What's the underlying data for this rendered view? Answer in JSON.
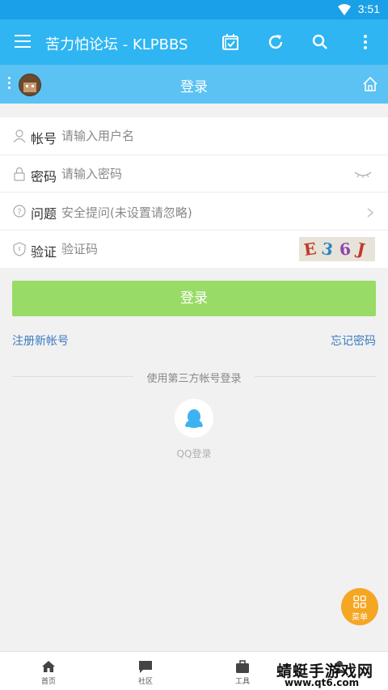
{
  "status_bar": {
    "time": "3:51"
  },
  "app_bar": {
    "title": "苦力怕论坛 - KLPBBS"
  },
  "sub_bar": {
    "title": "登录"
  },
  "form": {
    "username": {
      "label": "帐号",
      "placeholder": "请输入用户名"
    },
    "password": {
      "label": "密码",
      "placeholder": "请输入密码"
    },
    "question": {
      "label": "问题",
      "value": "安全提问(未设置请忽略)"
    },
    "captcha": {
      "label": "验证",
      "placeholder": "验证码",
      "image_text": [
        "E",
        "3",
        "6",
        "J"
      ]
    }
  },
  "login_button": "登录",
  "links": {
    "register": "注册新帐号",
    "forgot": "忘记密码"
  },
  "third_party": {
    "divider_text": "使用第三方帐号登录",
    "qq_label": "QQ登录"
  },
  "fab": {
    "label": "菜单"
  },
  "bottom_tabs": [
    {
      "label": "首页",
      "icon": "home-icon"
    },
    {
      "label": "社区",
      "icon": "chat-icon"
    },
    {
      "label": "工具",
      "icon": "briefcase-icon"
    },
    {
      "label": "",
      "icon": "profile-icon"
    }
  ],
  "watermark": {
    "line1": "蜻蜓手游戏网",
    "line2": "www.qt6.com"
  },
  "colors": {
    "primary": "#2eb5f2",
    "sub_bar": "#5bc2f3",
    "status_bar": "#1aa0e6",
    "login_button": "#98db66",
    "link": "#3a7bbf",
    "fab": "#f5a623"
  }
}
